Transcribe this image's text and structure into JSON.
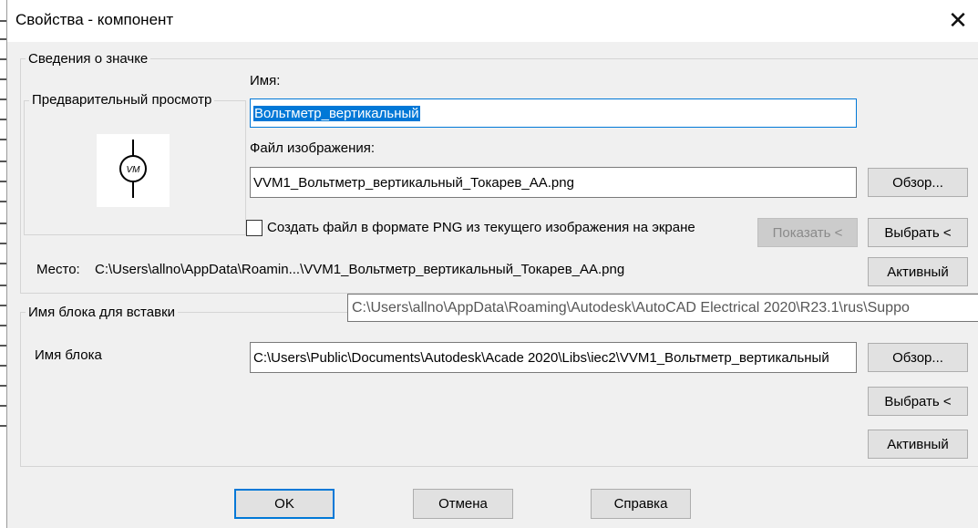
{
  "window": {
    "title": "Свойства - компонент",
    "close_glyph": "✕"
  },
  "icon_info": {
    "legend": "Сведения о значке",
    "preview_label": "Предварительный просмотр",
    "name_label": "Имя:",
    "name_value": "Вольтметр_вертикальный",
    "image_file_label": "Файл изображения:",
    "image_file_value": "VVM1_Вольтметр_вертикальный_Токарев_АА.png",
    "browse_label": "Обзор...",
    "create_png_label": "Создать файл в формате PNG из текущего изображения на экране",
    "create_png_checked": false,
    "show_label": "Показать <",
    "pick_label": "Выбрать <",
    "location_label": "Место:",
    "location_value": "C:\\Users\\allno\\AppData\\Roamin...\\VVM1_Вольтметр_вертикальный_Токарев_АА.png",
    "active_label": "Активный",
    "preview_symbol_text": "VM"
  },
  "tooltip": {
    "text": "C:\\Users\\allno\\AppData\\Roaming\\Autodesk\\AutoCAD Electrical 2020\\R23.1\\rus\\Suppo"
  },
  "block": {
    "legend": "Имя блока для вставки",
    "name_label": "Имя блока",
    "name_value": "C:\\Users\\Public\\Documents\\Autodesk\\Acade 2020\\Libs\\iec2\\VVM1_Вольтметр_вертикальный",
    "browse_label": "Обзор...",
    "pick_label": "Выбрать <",
    "active_label": "Активный"
  },
  "footer": {
    "ok_label": "OK",
    "cancel_label": "Отмена",
    "help_label": "Справка"
  },
  "colors": {
    "accent": "#0078d7",
    "dialog_bg": "#f0f0f0",
    "button_bg": "#e1e1e1"
  }
}
